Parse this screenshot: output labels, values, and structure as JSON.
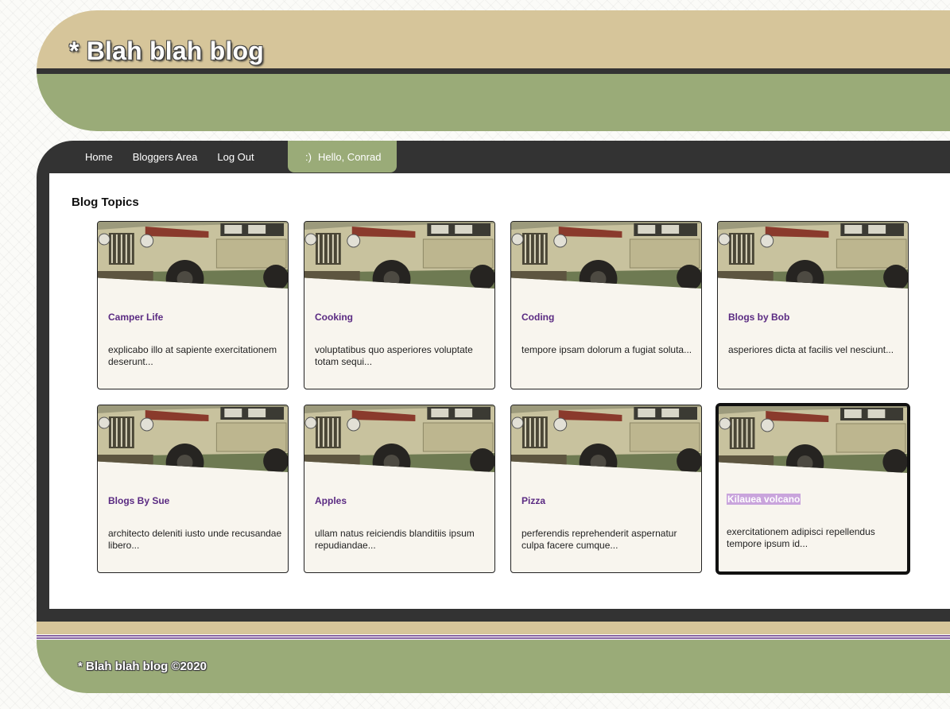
{
  "header": {
    "site_title": "* Blah blah blog"
  },
  "nav": {
    "links": [
      "Home",
      "Bloggers Area",
      "Log Out"
    ],
    "hello_icon": ":)",
    "hello_text": "Hello, Conrad"
  },
  "main": {
    "heading": "Blog Topics",
    "cards": [
      {
        "title": "Camper Life",
        "desc": "explicabo illo at sapiente exercitationem deserunt...",
        "image_icon": "vintage-truck-photo"
      },
      {
        "title": "Cooking",
        "desc": "voluptatibus quo asperiores voluptate totam sequi...",
        "image_icon": "vintage-truck-photo"
      },
      {
        "title": "Coding",
        "desc": "tempore ipsam dolorum a fugiat soluta...",
        "image_icon": "vintage-truck-photo"
      },
      {
        "title": "Blogs by Bob",
        "desc": "asperiores dicta at facilis vel nesciunt...",
        "image_icon": "vintage-truck-photo"
      },
      {
        "title": "Blogs By Sue",
        "desc": "architecto deleniti iusto unde recusandae libero...",
        "image_icon": "vintage-truck-photo"
      },
      {
        "title": "Apples",
        "desc": "ullam natus reiciendis blanditiis ipsum repudiandae...",
        "image_icon": "vintage-truck-photo"
      },
      {
        "title": "Pizza",
        "desc": "perferendis reprehenderit aspernatur culpa facere cumque...",
        "image_icon": "vintage-truck-photo"
      },
      {
        "title": "Kilauea volcano",
        "desc": "exercitationem adipisci repellendus tempore ipsum id...",
        "image_icon": "vintage-truck-photo",
        "selected": true
      }
    ]
  },
  "footer": {
    "text": "* Blah blah blog ©2020"
  },
  "colors": {
    "tan": "#d6c59a",
    "green": "#9aab78",
    "dark": "#333333",
    "card_bg": "#f8f5ee",
    "title_purple": "#5a2a82",
    "highlight": "#c9a4dc"
  }
}
